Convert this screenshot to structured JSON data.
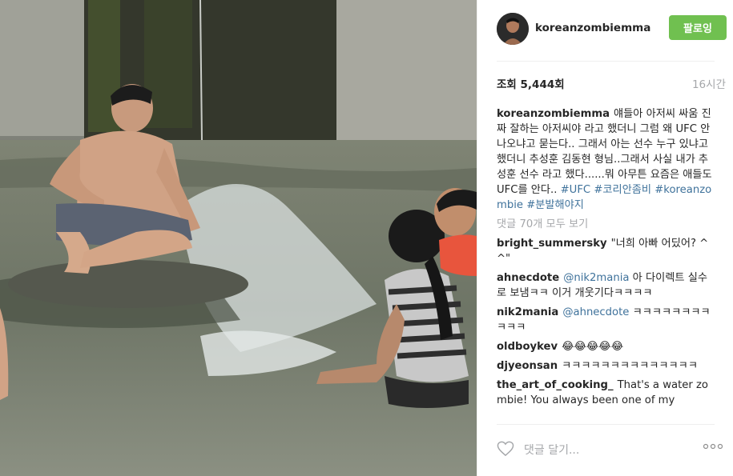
{
  "post": {
    "username": "koreanzombiemma",
    "follow_label": "팔로잉",
    "views": "조회 5,444회",
    "time": "16시간",
    "caption": {
      "user": "koreanzombiemma",
      "text": "얘들아 아저씨 싸움 진짜 잘하는 아저씨야 라고 했더니 그럼 왜 UFC 안나오냐고 묻는다.. 그래서 아는 선수 누구 있냐고 했더니 추성훈 김동현 형님..그래서 사실 내가 추성훈 선수 라고 했다......뭐 아무튼 요즘은 애들도 UFC를 안다..",
      "tags": [
        "#UFC",
        "#코리안좀비",
        "#koreanzombie",
        "#분발해야지"
      ]
    },
    "load_more": "댓글 70개 모두 보기",
    "comments": [
      {
        "user": "bright_summersky",
        "text": "\"너희 아빠 어딨어? ^^\""
      },
      {
        "user": "ahnecdote",
        "mention": "@nik2mania",
        "text": "아 다이렉트 실수로 보냄ㅋㅋ 이거 개웃기다ㅋㅋㅋㅋ"
      },
      {
        "user": "nik2mania",
        "mention": "@ahnecdote",
        "text": "ㅋㅋㅋㅋㅋㅋㅋㅋㅋㅋㅋ"
      },
      {
        "user": "oldboykev",
        "text": "😂😂😂😂😂"
      },
      {
        "user": "djyeonsan",
        "text": "ㅋㅋㅋㅋㅋㅋㅋㅋㅋㅋㅋㅋㅋㅋ"
      },
      {
        "user": "the_art_of_cooking_",
        "text": "That's a water zombie! You always been one of my"
      }
    ],
    "add_comment_placeholder": "댓글 달기...",
    "colors": {
      "follow": "#70c050",
      "link": "#3f729b",
      "muted": "#a5a7aa"
    }
  }
}
